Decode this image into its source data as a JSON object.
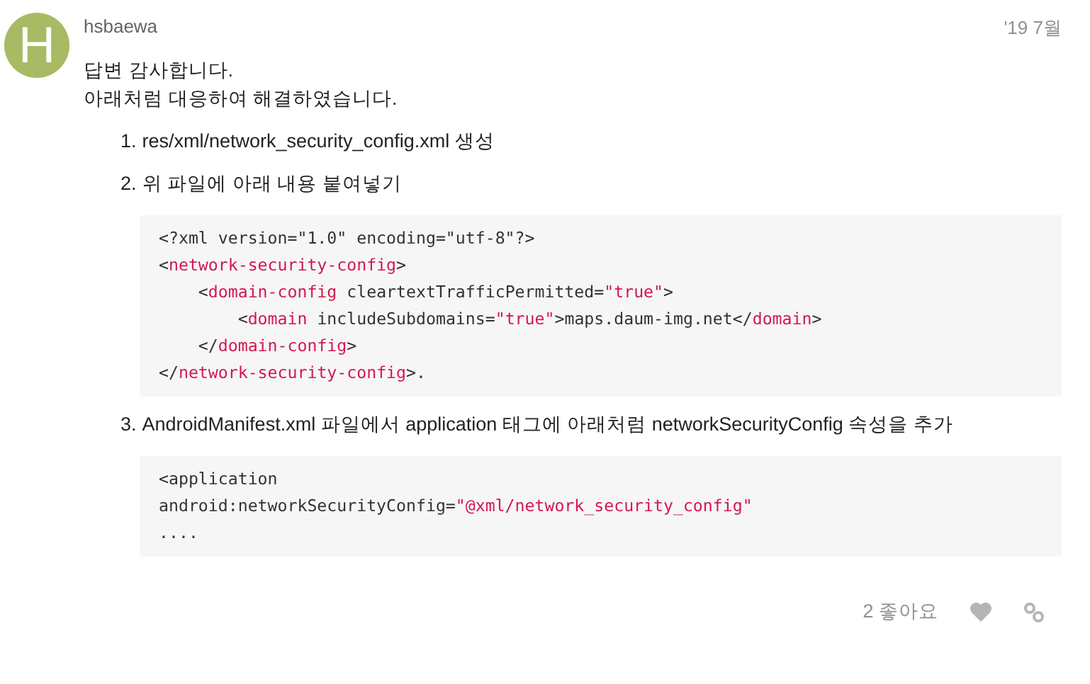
{
  "post": {
    "avatar_letter": "H",
    "username": "hsbaewa",
    "date": "'19 7월",
    "paragraph_lines": [
      "답변 감사합니다.",
      "아래처럼 대응하여 해결하였습니다."
    ],
    "steps": [
      {
        "number": "1.",
        "text": "res/xml/network_security_config.xml 생성"
      },
      {
        "number": "2.",
        "text": "위 파일에 아래 내용 붙여넣기",
        "code": [
          [
            {
              "kind": "plain",
              "text": "<?xml version=\"1.0\" encoding=\"utf-8\"?>"
            }
          ],
          [
            {
              "kind": "plain",
              "text": "<"
            },
            {
              "kind": "tag",
              "text": "network-security-config"
            },
            {
              "kind": "plain",
              "text": ">"
            }
          ],
          [
            {
              "kind": "plain",
              "text": "    <"
            },
            {
              "kind": "tag",
              "text": "domain-config"
            },
            {
              "kind": "plain",
              "text": " cleartextTrafficPermitted="
            },
            {
              "kind": "string",
              "text": "\"true\""
            },
            {
              "kind": "plain",
              "text": ">"
            }
          ],
          [
            {
              "kind": "plain",
              "text": "        <"
            },
            {
              "kind": "tag",
              "text": "domain"
            },
            {
              "kind": "plain",
              "text": " includeSubdomains="
            },
            {
              "kind": "string",
              "text": "\"true\""
            },
            {
              "kind": "plain",
              "text": ">maps.daum-img.net</"
            },
            {
              "kind": "tag",
              "text": "domain"
            },
            {
              "kind": "plain",
              "text": ">"
            }
          ],
          [
            {
              "kind": "plain",
              "text": "    </"
            },
            {
              "kind": "tag",
              "text": "domain-config"
            },
            {
              "kind": "plain",
              "text": ">"
            }
          ],
          [
            {
              "kind": "plain",
              "text": "</"
            },
            {
              "kind": "tag",
              "text": "network-security-config"
            },
            {
              "kind": "plain",
              "text": ">."
            }
          ]
        ]
      },
      {
        "number": "3.",
        "text": "AndroidManifest.xml 파일에서 application 태그에 아래처럼 networkSecurityConfig 속성을 추가",
        "code": [
          [
            {
              "kind": "plain",
              "text": "<application"
            }
          ],
          [
            {
              "kind": "plain",
              "text": "android:networkSecurityConfig="
            },
            {
              "kind": "string",
              "text": "\"@xml/network_security_config\""
            }
          ],
          [
            {
              "kind": "plain",
              "text": "...."
            }
          ]
        ]
      }
    ],
    "likes": "2 좋아요"
  }
}
